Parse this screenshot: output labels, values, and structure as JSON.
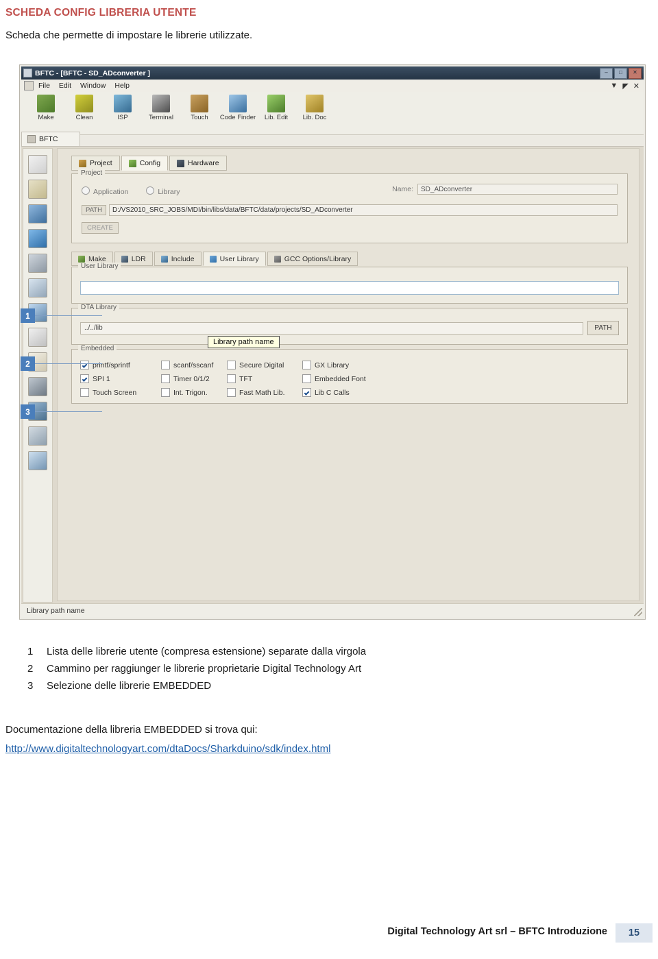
{
  "document": {
    "title": "SCHEDA CONFIG LIBRERIA UTENTE",
    "subtitle": "Scheda che permette di impostare le librerie utilizzate.",
    "accent_color": "#c0504d",
    "marker_color": "#4a7ebb"
  },
  "screenshot": {
    "titlebar": {
      "text": "BFTC - [BFTC - SD_ADconverter ]",
      "minimize": "–",
      "maximize": "□",
      "close": "✕"
    },
    "menubar": {
      "items": [
        "File",
        "Edit",
        "Window",
        "Help"
      ],
      "right_icons": [
        "▼",
        "◤",
        "✕"
      ]
    },
    "toolbar": [
      {
        "label": "Make",
        "icon": "make-icon"
      },
      {
        "label": "Clean",
        "icon": "clean-icon"
      },
      {
        "label": "ISP",
        "icon": "isp-icon"
      },
      {
        "label": "Terminal",
        "icon": "terminal-icon"
      },
      {
        "label": "Touch",
        "icon": "touch-icon"
      },
      {
        "label": "Code Finder",
        "icon": "code-finder-icon"
      },
      {
        "label": "Lib. Edit",
        "icon": "lib-edit-icon"
      },
      {
        "label": "Lib. Doc",
        "icon": "lib-doc-icon"
      }
    ],
    "doc_tab": "BFTC",
    "tabs": [
      {
        "label": "Project",
        "active": false
      },
      {
        "label": "Config",
        "active": true
      },
      {
        "label": "Hardware",
        "active": false
      }
    ],
    "project_group": {
      "legend": "Project",
      "radios": [
        "Application",
        "Library"
      ],
      "name_label": "Name:",
      "name_value": "SD_ADconverter",
      "path_badge": "PATH",
      "path_value": "D:/VS2010_SRC_JOBS/MDI/bin/libs/data/BFTC/data/projects/SD_ADconverter",
      "create_label": "CREATE"
    },
    "sub_tabs": [
      {
        "label": "Make",
        "active": false
      },
      {
        "label": "LDR",
        "active": false
      },
      {
        "label": "Include",
        "active": false
      },
      {
        "label": "User Library",
        "active": true
      },
      {
        "label": "GCC Options/Library",
        "active": false
      }
    ],
    "user_library_group": {
      "legend": "User Library",
      "value": ""
    },
    "dta_library_group": {
      "legend": "DTA Library",
      "value": "../../lib",
      "button": "PATH"
    },
    "embedded_group": {
      "legend": "Embedded",
      "items": [
        {
          "label": "printf/sprintf",
          "checked": true
        },
        {
          "label": "scanf/sscanf",
          "checked": false
        },
        {
          "label": "Secure Digital",
          "checked": false
        },
        {
          "label": "GX Library",
          "checked": false
        },
        {
          "label": "SPI 1",
          "checked": true
        },
        {
          "label": "Timer 0/1/2",
          "checked": false
        },
        {
          "label": "TFT",
          "checked": false
        },
        {
          "label": "Embedded Font",
          "checked": false
        },
        {
          "label": "Touch Screen",
          "checked": false
        },
        {
          "label": "Int. Trigon.",
          "checked": false
        },
        {
          "label": "Fast Math Lib.",
          "checked": false
        },
        {
          "label": "Lib C Calls",
          "checked": true
        }
      ]
    },
    "tooltip": "Library path name",
    "statusbar": "Library path name",
    "markers": [
      "1",
      "2",
      "3"
    ]
  },
  "legend": {
    "items": [
      {
        "num": "1",
        "text": "Lista delle librerie utente (compresa estensione) separate dalla virgola"
      },
      {
        "num": "2",
        "text": "Cammino per raggiunger le librerie proprietarie Digital Technology Art"
      },
      {
        "num": "3",
        "text": "Selezione delle librerie EMBEDDED"
      }
    ]
  },
  "body": {
    "doc_note": "Documentazione della libreria EMBEDDED si trova qui:",
    "link": "http://www.digitaltechnologyart.com/dtaDocs/Sharkduino/sdk/index.html"
  },
  "footer": {
    "text": "Digital Technology Art srl – BFTC Introduzione",
    "page": "15"
  }
}
